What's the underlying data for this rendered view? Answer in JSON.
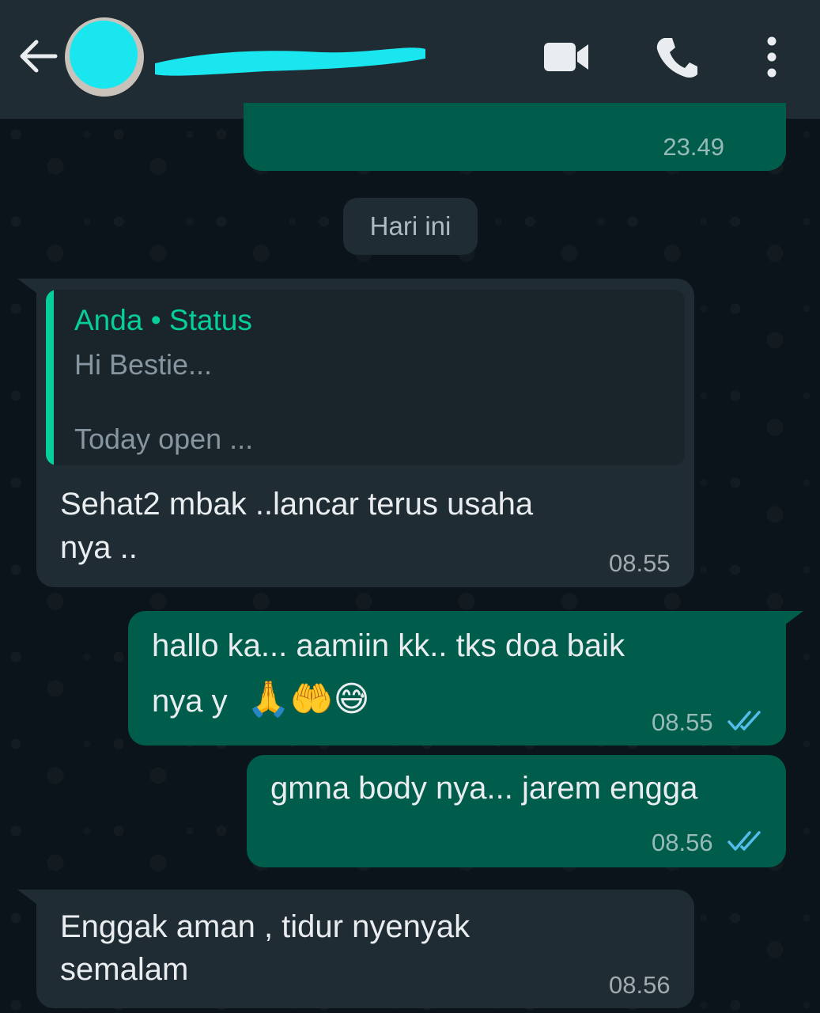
{
  "header": {
    "contact_name": "",
    "back_label": "back",
    "icons": [
      "arrow-left-icon",
      "video-call-icon",
      "phone-icon",
      "more-vert-icon"
    ]
  },
  "colors": {
    "header_bg": "#1f2c34",
    "chat_bg": "#0b141a",
    "outgoing_bubble": "#005c4b",
    "incoming_bubble": "#1f2c34",
    "accent": "#06cf9c",
    "read_ticks": "#53bdeb"
  },
  "date_separator": "Hari ini",
  "messages": [
    {
      "direction": "outgoing",
      "time": "23.49",
      "text": ""
    },
    {
      "direction": "incoming",
      "quote": {
        "author": "Anda • Status",
        "line1": "Hi Bestie...",
        "line2": "Today open ..."
      },
      "line1": "Sehat2 mbak ..lancar terus usaha",
      "line2": "nya ..",
      "time": "08.55"
    },
    {
      "direction": "outgoing",
      "line1": "hallo ka... aamiin kk.. tks doa baik",
      "line2": "nya y",
      "emojis": "🙏🤲😅",
      "time": "08.55",
      "status": "read"
    },
    {
      "direction": "outgoing",
      "line1": "gmna body nya... jarem engga",
      "time": "08.56",
      "status": "read"
    },
    {
      "direction": "incoming",
      "line1": "Enggak aman , tidur nyenyak",
      "line2": "semalam",
      "time": "08.56"
    }
  ]
}
